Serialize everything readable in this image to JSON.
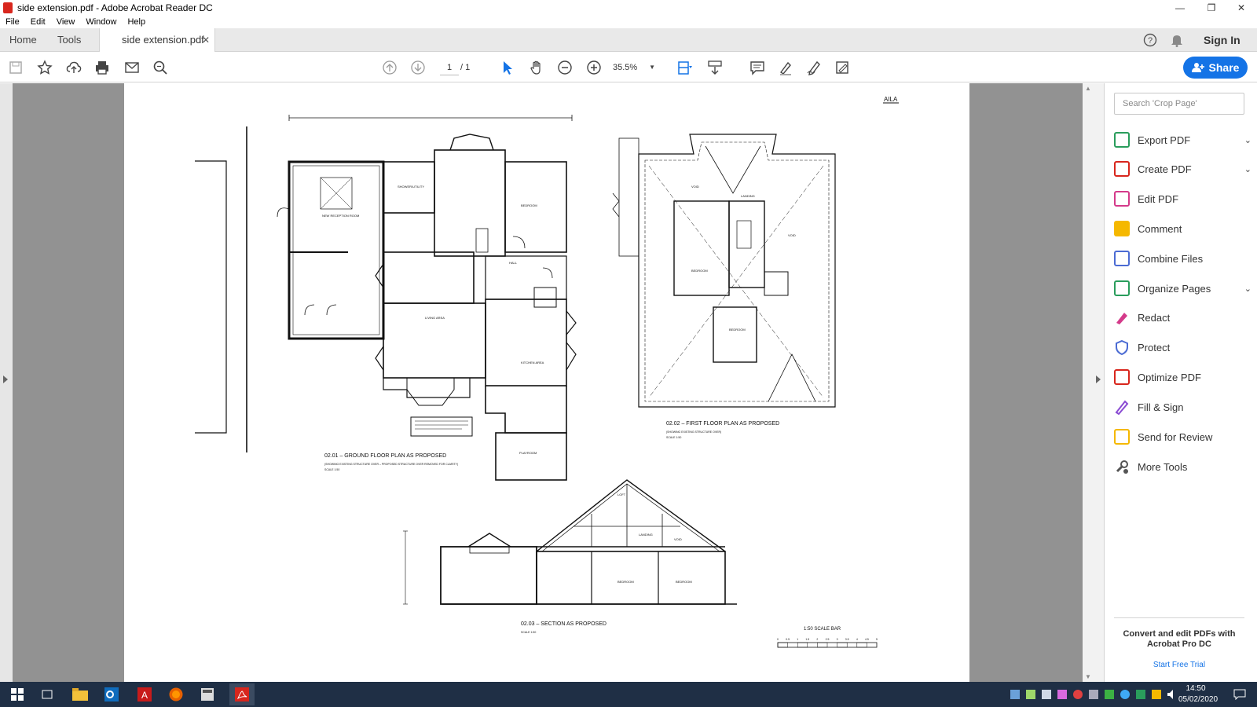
{
  "window": {
    "title": "side extension.pdf - Adobe Acrobat Reader DC"
  },
  "menu": [
    "File",
    "Edit",
    "View",
    "Window",
    "Help"
  ],
  "tabs": {
    "home": "Home",
    "tools": "Tools",
    "document": "side extension.pdf"
  },
  "header": {
    "sign_in": "Sign In",
    "share": "Share"
  },
  "toolbar": {
    "page_current": "1",
    "page_total": "/ 1",
    "zoom": "35.5%"
  },
  "right_panel": {
    "search_placeholder": "Search 'Crop Page'",
    "tools": [
      {
        "label": "Export PDF",
        "color": "#2a9d5c",
        "expandable": true
      },
      {
        "label": "Create PDF",
        "color": "#d8261d",
        "expandable": true
      },
      {
        "label": "Edit PDF",
        "color": "#d43a8a",
        "expandable": false
      },
      {
        "label": "Comment",
        "color": "#f5b800",
        "expandable": false
      },
      {
        "label": "Combine Files",
        "color": "#4b6bd3",
        "expandable": false
      },
      {
        "label": "Organize Pages",
        "color": "#2a9d5c",
        "expandable": true
      },
      {
        "label": "Redact",
        "color": "#d43a8a",
        "expandable": false
      },
      {
        "label": "Protect",
        "color": "#4b6bd3",
        "expandable": false
      },
      {
        "label": "Optimize PDF",
        "color": "#d8261d",
        "expandable": false
      },
      {
        "label": "Fill & Sign",
        "color": "#8a4bd3",
        "expandable": false
      },
      {
        "label": "Send for Review",
        "color": "#f5b800",
        "expandable": false
      },
      {
        "label": "More Tools",
        "color": "#555555",
        "expandable": false
      }
    ],
    "promo_title": "Convert and edit PDFs with Acrobat Pro DC",
    "promo_link": "Start Free Trial"
  },
  "drawing": {
    "stamp": "AILA",
    "ground_title": "02.01 – GROUND FLOOR PLAN AS PROPOSED",
    "ground_sub": "(SHOWING EXISTING STRUCTURE OVER – PROPOSED STRUCTURE OVER REMOVED FOR CLARITY)",
    "ground_scale": "SCALE 1:50",
    "first_title": "02.02 – FIRST FLOOR PLAN AS PROPOSED",
    "first_sub": "(SHOWING EXISTING STRUCTURE OVER)",
    "first_scale": "SCALE 1:50",
    "section_title": "02.03 – SECTION AS PROPOSED",
    "section_scale": "SCALE 1:50",
    "scalebar_title": "1:50 SCALE BAR",
    "scalebar_ticks": [
      "0",
      "0.5",
      "1",
      "1.5",
      "2",
      "2.5",
      "3",
      "3.5",
      "4",
      "4.5",
      "5"
    ],
    "rooms": {
      "bedroom": "BEDROOM",
      "living": "LIVING AREA",
      "kitchen": "KITCHEN AREA",
      "playroom": "PLAYROOM",
      "shower": "SHOWER/UTILITY",
      "hall": "HALL",
      "loft": "LOFT",
      "landing": "LANDING",
      "void": "VOID",
      "reception": "NEW RECEPTION ROOM"
    }
  },
  "taskbar": {
    "time": "14:50",
    "date": "05/02/2020"
  }
}
